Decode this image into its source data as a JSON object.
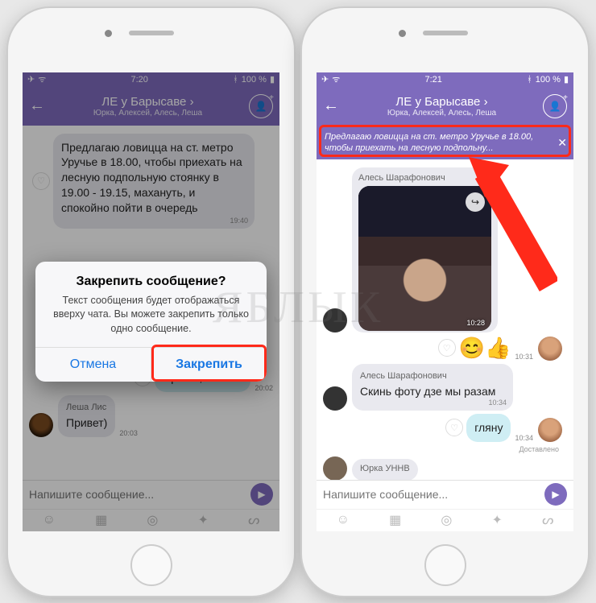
{
  "status": {
    "time": "7:20",
    "battery": "100 %",
    "time2": "7:21",
    "bt_icon": "bluetooth-icon",
    "plane_icon": "airplane-icon",
    "wifi_icon": "wifi-icon"
  },
  "header": {
    "title": "ЛЕ у Барысаве ›",
    "subtitle": "Юрка, Алексей, Алесь, Леша",
    "subtitle2": "Юрка, Алексей, Алесь, Леша"
  },
  "pinned": {
    "text": "Предлагаю ловицца на ст. метро Уручье в 18.00, чтобы приехать на лесную подпольну..."
  },
  "messages_left": {
    "big": "Предлагаю ловицца на ст. метро Уручье в 18.00, чтобы приехать на лесную подпольную стоянку в 19.00 - 19.15, махануть, и спокойно пойти в очередь",
    "big_time": "19:40",
    "out1": "Привет, Лешка!",
    "out1_time": "20:02",
    "in1_sender": "Леша Лис",
    "in1": "Привет)",
    "in1_time": "20:03"
  },
  "messages_right": {
    "photo_sender": "Алесь Шарафонович",
    "photo_time": "10:28",
    "sticker_time": "10:31",
    "in2_sender": "Алесь Шарафонович",
    "in2": "Скинь фоту дзе мы разам",
    "in2_time": "10:34",
    "out2": "гляну",
    "out2_time": "10:34",
    "delivered": "Доставлено",
    "in3_sender": "Юрка УННВ"
  },
  "alert": {
    "title": "Закрепить сообщение?",
    "text": "Текст сообщения будет отображаться вверху чата. Вы можете закрепить только одно сообщение.",
    "cancel": "Отмена",
    "confirm": "Закрепить"
  },
  "input": {
    "placeholder": "Напишите сообщение..."
  },
  "watermark": "ЯБЛЫК"
}
